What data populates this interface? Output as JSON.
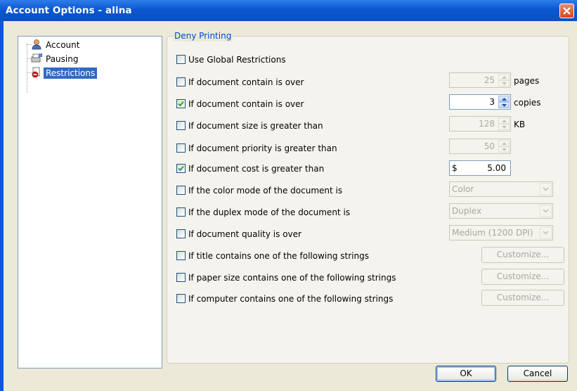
{
  "window": {
    "title": "Account Options - alina"
  },
  "tree": {
    "items": [
      {
        "label": "Account",
        "icon": "user-icon"
      },
      {
        "label": "Pausing",
        "icon": "printer-pause-icon"
      },
      {
        "label": "Restrictions",
        "icon": "restrictions-icon",
        "selected": true
      }
    ]
  },
  "group": {
    "title": "Deny Printing"
  },
  "options": {
    "global": {
      "label": "Use Global Restrictions",
      "checked": false
    },
    "pages": {
      "label": "If document contain is over",
      "checked": false,
      "value": "25",
      "unit": "pages"
    },
    "copies": {
      "label": "If document contain is over",
      "checked": true,
      "value": "3",
      "unit": "copies"
    },
    "size": {
      "label": "If document size is greater than",
      "checked": false,
      "value": "128",
      "unit": "KB"
    },
    "priority": {
      "label": "If document priority is greater than",
      "checked": false,
      "value": "50"
    },
    "cost": {
      "label": "If document cost is greater than",
      "checked": true,
      "currency": "$",
      "value": "5.00"
    },
    "color": {
      "label": "If the color mode of the document is",
      "checked": false,
      "selected": "Color"
    },
    "duplex": {
      "label": "If the duplex mode of the document is",
      "checked": false,
      "selected": "Duplex"
    },
    "quality": {
      "label": "If document quality is over",
      "checked": false,
      "selected": "Medium (1200 DPI)"
    },
    "title_strings": {
      "label": "If title contains one of the following strings",
      "checked": false,
      "button": "Customize..."
    },
    "paper_strings": {
      "label": "If paper size contains one of the following strings",
      "checked": false,
      "button": "Customize..."
    },
    "computer_strings": {
      "label": "If computer contains one of the following strings",
      "checked": false,
      "button": "Customize..."
    }
  },
  "buttons": {
    "ok": "OK",
    "cancel": "Cancel"
  },
  "colors": {
    "titlebar": "#0a58d0",
    "dialog_bg": "#ece9d8",
    "selection": "#316ac5",
    "group_title": "#0046d5"
  }
}
